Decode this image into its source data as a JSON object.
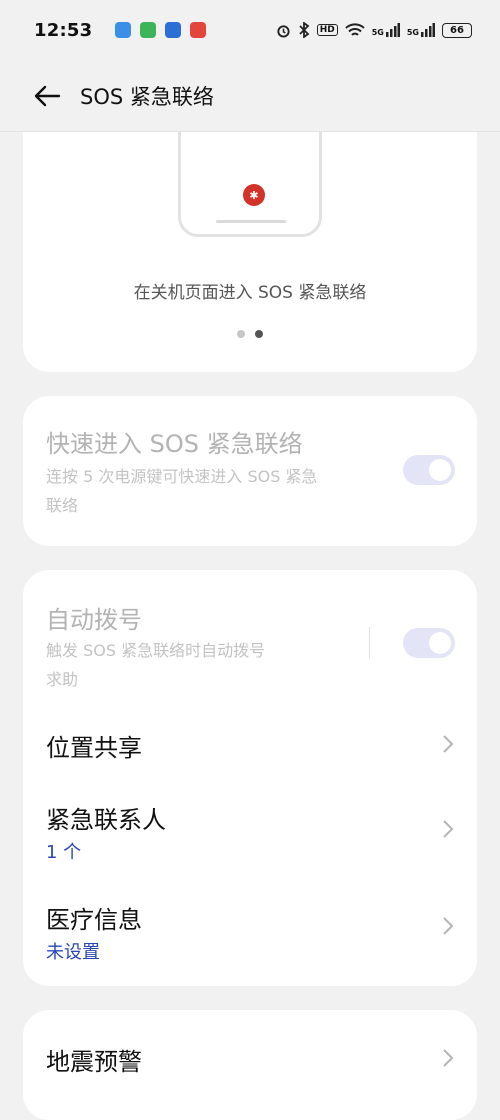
{
  "status": {
    "time": "12:53",
    "network_labels": [
      "5G",
      "5G"
    ],
    "hd_label": "HD",
    "battery": "66"
  },
  "header": {
    "title": "SOS 紧急联络"
  },
  "illustration": {
    "caption": "在关机页面进入 SOS 紧急联络",
    "page_count": 2,
    "active_page": 2
  },
  "quick_entry": {
    "title": "快速进入 SOS 紧急联络",
    "desc_line1": "连按 5 次电源键可快速进入 SOS 紧急",
    "desc_line2": "联络"
  },
  "auto_dial": {
    "title": "自动拨号",
    "desc_line1": "触发 SOS 紧急联络时自动拨号",
    "desc_line2": "求助"
  },
  "location_share": {
    "title": "位置共享"
  },
  "emergency_contacts": {
    "title": "紧急联系人",
    "value": "1 个"
  },
  "medical_info": {
    "title": "医疗信息",
    "value": "未设置"
  },
  "earthquake": {
    "title": "地震预警"
  },
  "colors": {
    "accent_blue": "#2a47b8",
    "sos_red": "#d23227",
    "toggle_disabled": "#e4e4f7"
  }
}
